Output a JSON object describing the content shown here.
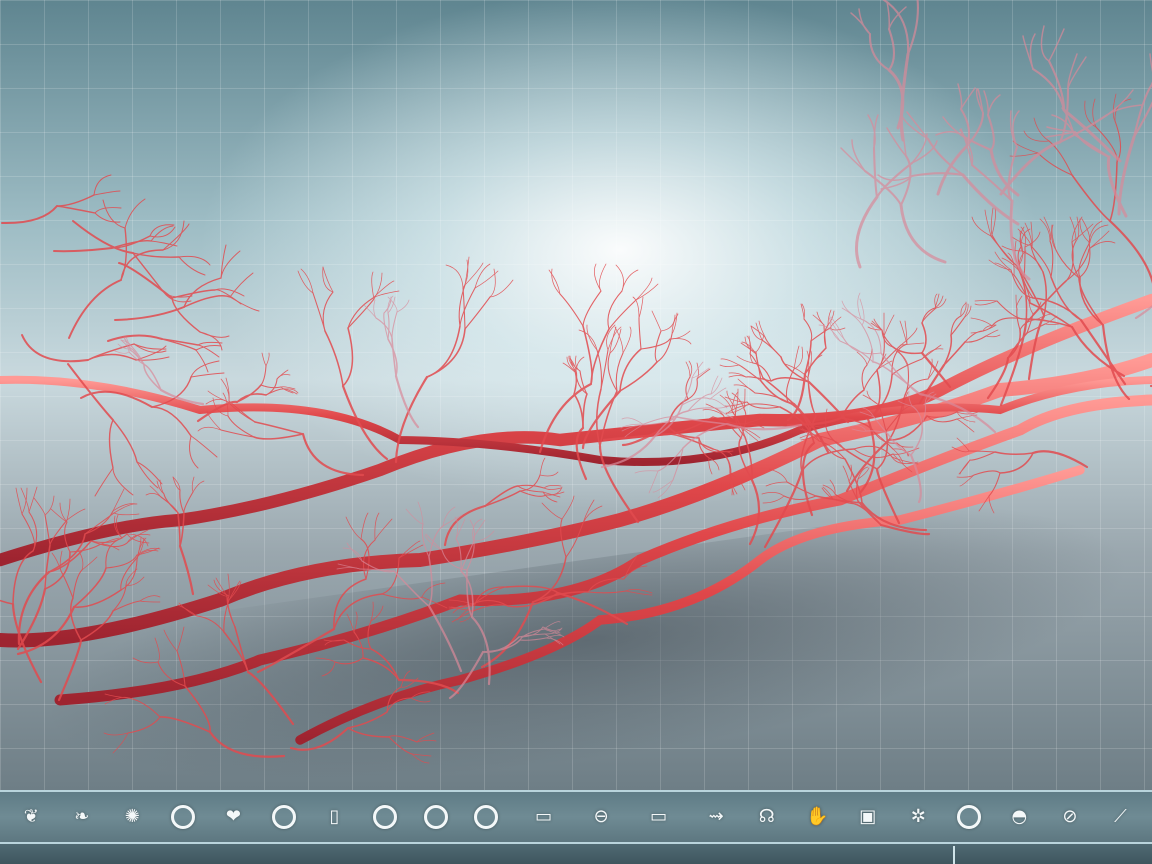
{
  "scene": {
    "subject": "3D blood vessel network illustration",
    "palette": {
      "vessel": "#e0474a",
      "vessel_highlight": "#ff8a86",
      "vessel_pale": "#d98a9a",
      "background": "#9dbcc4",
      "glow": "#ffffff"
    }
  },
  "icon_bar": {
    "icons": [
      {
        "name": "organ-icon",
        "glyph": "❦"
      },
      {
        "name": "lungs-icon",
        "glyph": "❧"
      },
      {
        "name": "brain-icon",
        "glyph": "✺"
      },
      {
        "name": "cell-icon",
        "glyph": "ring"
      },
      {
        "name": "heart-icon",
        "glyph": "❤"
      },
      {
        "name": "kidney-icon",
        "glyph": "ring"
      },
      {
        "name": "capsule-icon",
        "glyph": "▯"
      },
      {
        "name": "eye-icon",
        "glyph": "ring"
      },
      {
        "name": "lens-icon",
        "glyph": "ring"
      },
      {
        "name": "ring-icon",
        "glyph": "ring"
      },
      {
        "name": "screen-icon",
        "glyph": "▭"
      },
      {
        "name": "minus-circle-icon",
        "glyph": "⊖"
      },
      {
        "name": "monitor-icon",
        "glyph": "▭"
      },
      {
        "name": "syringe-icon",
        "glyph": "⇝"
      },
      {
        "name": "stethoscope-icon",
        "glyph": "☊"
      },
      {
        "name": "hands-icon",
        "glyph": "✋"
      },
      {
        "name": "tooth-icon",
        "glyph": "▣"
      },
      {
        "name": "molecule-icon",
        "glyph": "✲"
      },
      {
        "name": "circle-icon",
        "glyph": "ring"
      },
      {
        "name": "mask-icon",
        "glyph": "◓"
      },
      {
        "name": "dna-icon",
        "glyph": "⊘"
      },
      {
        "name": "bandage-icon",
        "glyph": "⟋"
      }
    ]
  }
}
